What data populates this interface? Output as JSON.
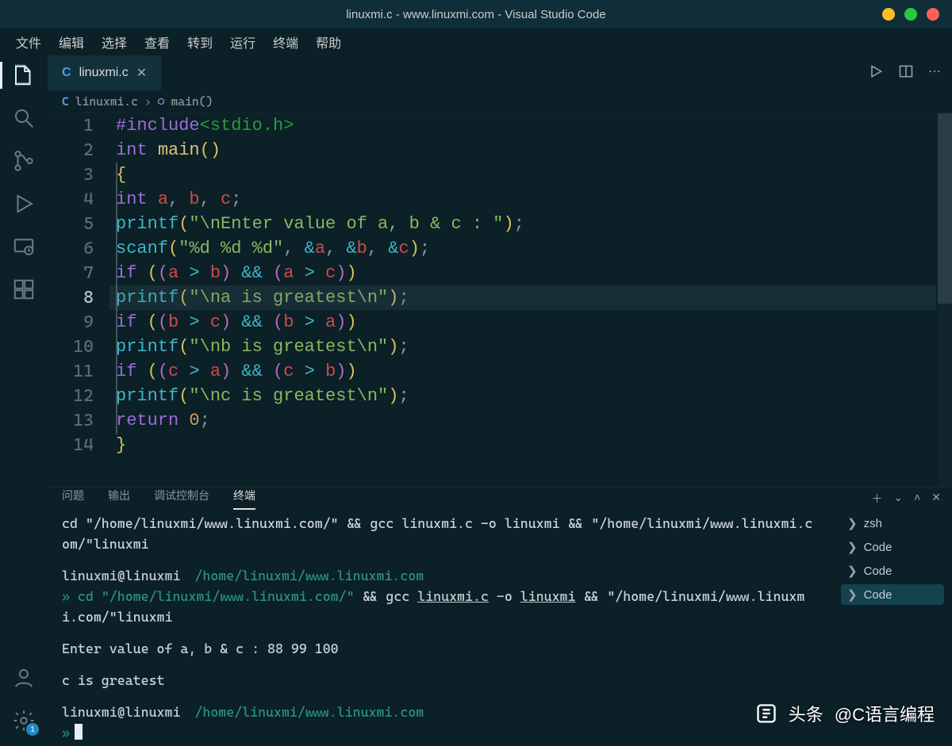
{
  "titlebar": {
    "title": "linuxmi.c - www.linuxmi.com - Visual Studio Code"
  },
  "menubar": [
    "文件",
    "编辑",
    "选择",
    "查看",
    "转到",
    "运行",
    "终端",
    "帮助"
  ],
  "tabs": [
    {
      "icon": "C",
      "label": "linuxmi.c"
    }
  ],
  "breadcrumbs": {
    "file_icon": "C",
    "file": "linuxmi.c",
    "symbol": "main()"
  },
  "activity": {
    "badge": "1"
  },
  "editor": {
    "current_line": 8,
    "lines": [
      [
        {
          "c": "kw",
          "t": "#include"
        },
        {
          "c": "inc",
          "t": "<stdio.h>"
        }
      ],
      [
        {
          "c": "type",
          "t": "int "
        },
        {
          "c": "fn2",
          "t": "main"
        },
        {
          "c": "paren",
          "t": "()"
        }
      ],
      [
        {
          "c": "brace",
          "t": "{"
        }
      ],
      [
        {
          "c": "type",
          "t": "int "
        },
        {
          "c": "id",
          "t": "a"
        },
        {
          "c": "pun",
          "t": ", "
        },
        {
          "c": "id",
          "t": "b"
        },
        {
          "c": "pun",
          "t": ", "
        },
        {
          "c": "id",
          "t": "c"
        },
        {
          "c": "pun",
          "t": ";"
        }
      ],
      [
        {
          "c": "fn",
          "t": "printf"
        },
        {
          "c": "paren",
          "t": "("
        },
        {
          "c": "str",
          "t": "\"\\nEnter value of a, b & c : \""
        },
        {
          "c": "paren",
          "t": ")"
        },
        {
          "c": "pun",
          "t": ";"
        }
      ],
      [
        {
          "c": "fn",
          "t": "scanf"
        },
        {
          "c": "paren",
          "t": "("
        },
        {
          "c": "str",
          "t": "\"%d %d %d\""
        },
        {
          "c": "pun",
          "t": ", "
        },
        {
          "c": "op",
          "t": "&"
        },
        {
          "c": "id",
          "t": "a"
        },
        {
          "c": "pun",
          "t": ", "
        },
        {
          "c": "op",
          "t": "&"
        },
        {
          "c": "id",
          "t": "b"
        },
        {
          "c": "pun",
          "t": ", "
        },
        {
          "c": "op",
          "t": "&"
        },
        {
          "c": "id",
          "t": "c"
        },
        {
          "c": "paren",
          "t": ")"
        },
        {
          "c": "pun",
          "t": ";"
        }
      ],
      [
        {
          "c": "kw",
          "t": "if "
        },
        {
          "c": "paren",
          "t": "("
        },
        {
          "c": "paren2",
          "t": "("
        },
        {
          "c": "id",
          "t": "a"
        },
        {
          "c": "op",
          "t": " > "
        },
        {
          "c": "id",
          "t": "b"
        },
        {
          "c": "paren2",
          "t": ")"
        },
        {
          "c": "op",
          "t": " && "
        },
        {
          "c": "paren2",
          "t": "("
        },
        {
          "c": "id",
          "t": "a"
        },
        {
          "c": "op",
          "t": " > "
        },
        {
          "c": "id",
          "t": "c"
        },
        {
          "c": "paren2",
          "t": ")"
        },
        {
          "c": "paren",
          "t": ")"
        }
      ],
      [
        {
          "c": "fn",
          "t": "printf"
        },
        {
          "c": "paren",
          "t": "("
        },
        {
          "c": "str",
          "t": "\"\\na is greatest\\n\""
        },
        {
          "c": "paren",
          "t": ")"
        },
        {
          "c": "pun",
          "t": ";"
        }
      ],
      [
        {
          "c": "kw",
          "t": "if "
        },
        {
          "c": "paren",
          "t": "("
        },
        {
          "c": "paren2",
          "t": "("
        },
        {
          "c": "id",
          "t": "b"
        },
        {
          "c": "op",
          "t": " > "
        },
        {
          "c": "id",
          "t": "c"
        },
        {
          "c": "paren2",
          "t": ")"
        },
        {
          "c": "op",
          "t": " && "
        },
        {
          "c": "paren2",
          "t": "("
        },
        {
          "c": "id",
          "t": "b"
        },
        {
          "c": "op",
          "t": " > "
        },
        {
          "c": "id",
          "t": "a"
        },
        {
          "c": "paren2",
          "t": ")"
        },
        {
          "c": "paren",
          "t": ")"
        }
      ],
      [
        {
          "c": "fn",
          "t": "printf"
        },
        {
          "c": "paren",
          "t": "("
        },
        {
          "c": "str",
          "t": "\"\\nb is greatest\\n\""
        },
        {
          "c": "paren",
          "t": ")"
        },
        {
          "c": "pun",
          "t": ";"
        }
      ],
      [
        {
          "c": "kw",
          "t": "if "
        },
        {
          "c": "paren",
          "t": "("
        },
        {
          "c": "paren2",
          "t": "("
        },
        {
          "c": "id",
          "t": "c"
        },
        {
          "c": "op",
          "t": " > "
        },
        {
          "c": "id",
          "t": "a"
        },
        {
          "c": "paren2",
          "t": ")"
        },
        {
          "c": "op",
          "t": " && "
        },
        {
          "c": "paren2",
          "t": "("
        },
        {
          "c": "id",
          "t": "c"
        },
        {
          "c": "op",
          "t": " > "
        },
        {
          "c": "id",
          "t": "b"
        },
        {
          "c": "paren2",
          "t": ")"
        },
        {
          "c": "paren",
          "t": ")"
        }
      ],
      [
        {
          "c": "fn",
          "t": "printf"
        },
        {
          "c": "paren",
          "t": "("
        },
        {
          "c": "str",
          "t": "\"\\nc is greatest\\n\""
        },
        {
          "c": "paren",
          "t": ")"
        },
        {
          "c": "pun",
          "t": ";"
        }
      ],
      [
        {
          "c": "kw",
          "t": "return "
        },
        {
          "c": "num",
          "t": "0"
        },
        {
          "c": "pun",
          "t": ";"
        }
      ],
      [
        {
          "c": "brace",
          "t": "}"
        }
      ]
    ]
  },
  "panel": {
    "tabs": {
      "problems": "问题",
      "output": "输出",
      "debug": "调试控制台",
      "terminal": "终端"
    },
    "terminal_items": [
      "zsh",
      "Code",
      "Code",
      "Code"
    ],
    "terminal_selected": 3,
    "output": {
      "l1": "cd \"/home/linuxmi/www.linuxmi.com/\" && gcc linuxmi.c -o linuxmi && \"/home/linuxmi/www.linuxmi.com/\"linuxmi",
      "user": "linuxmi@linuxmi",
      "path": "/home/linuxmi/www.linuxmi.com",
      "cmd_prefix": "cd ",
      "cmd_str": "\"/home/linuxmi/www.linuxmi.com/\"",
      "cmd_mid": " && gcc ",
      "cmd_link1": "linuxmi.c",
      "cmd_mid2": " -o ",
      "cmd_link2": "linuxmi",
      "cmd_tail": " && \"/home/linuxmi/www.linuxmi.com/\"linuxmi",
      "input_line": "Enter value of a, b & c : 88 99 100",
      "result": "c is greatest"
    }
  },
  "watermark": {
    "label": "头条",
    "handle": "@C语言编程"
  }
}
